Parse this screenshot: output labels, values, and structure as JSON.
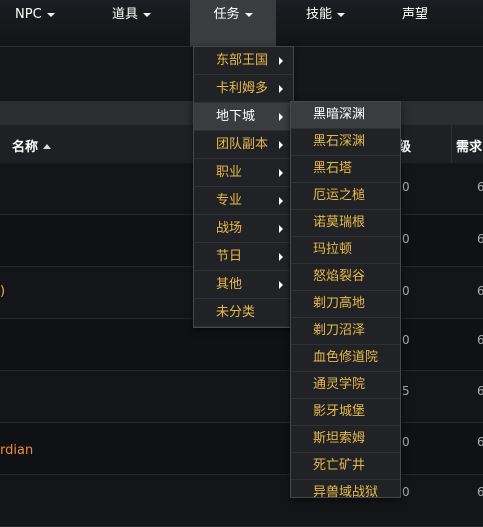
{
  "nav": {
    "items": [
      {
        "label": "NPC",
        "has_caret": true
      },
      {
        "label": "道具",
        "has_caret": true
      },
      {
        "label": "任务",
        "has_caret": true
      },
      {
        "label": "技能",
        "has_caret": true
      },
      {
        "label": "声望",
        "has_caret": false
      }
    ]
  },
  "table": {
    "headers": {
      "name": "名称",
      "level": "级",
      "required": "需求"
    },
    "rows": [
      {
        "level": "0",
        "required": "6",
        "extra": ""
      },
      {
        "level": "0",
        "required": "6",
        "extra": ""
      },
      {
        "level": "0",
        "required": "6",
        "extra": ")"
      },
      {
        "level": "0",
        "required": "6",
        "extra": ""
      },
      {
        "level": "5",
        "required": "6",
        "extra": ""
      },
      {
        "level": "0",
        "required": "6",
        "extra": "rdian"
      },
      {
        "level": "0",
        "required": "6",
        "extra": ""
      }
    ]
  },
  "quest_menu": {
    "items": [
      {
        "label": "东部王国",
        "submenu": true
      },
      {
        "label": "卡利姆多",
        "submenu": true
      },
      {
        "label": "地下城",
        "submenu": true,
        "active": true
      },
      {
        "label": "团队副本",
        "submenu": true
      },
      {
        "label": "职业",
        "submenu": true
      },
      {
        "label": "专业",
        "submenu": true
      },
      {
        "label": "战场",
        "submenu": true
      },
      {
        "label": "节日",
        "submenu": true
      },
      {
        "label": "其他",
        "submenu": true
      },
      {
        "label": "未分类",
        "submenu": false
      }
    ]
  },
  "dungeon_menu": {
    "items": [
      "黑暗深渊",
      "黑石深渊",
      "黑石塔",
      "厄运之槌",
      "诺莫瑞根",
      "玛拉顿",
      "怒焰裂谷",
      "剃刀高地",
      "剃刀沼泽",
      "血色修道院",
      "通灵学院",
      "影牙城堡",
      "斯坦索姆",
      "死亡矿井",
      "异兽域战狱"
    ],
    "highlighted_index": 0
  },
  "colors": {
    "accent": "#e8b94a",
    "extra_orange": "#f08c33"
  }
}
